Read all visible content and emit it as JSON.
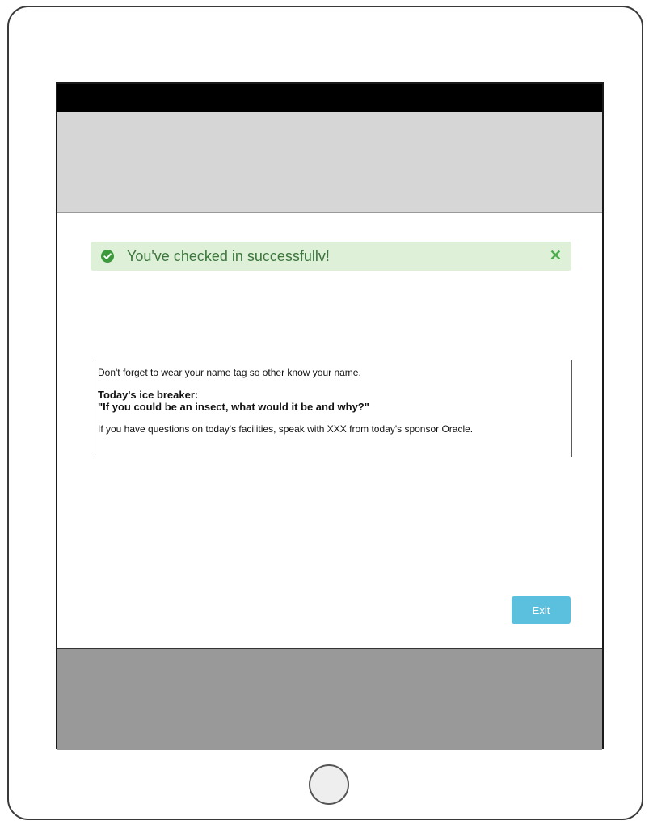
{
  "alert": {
    "message": "You've checked in successfullv!",
    "icon": "check-circle-icon",
    "close_icon": "close-icon",
    "close_glyph": "✕",
    "bg_color": "#dff0d8",
    "text_color": "#3c763d"
  },
  "info": {
    "line1": "Don't forget to wear your name tag so other know your name.",
    "ice_breaker_title": "Today's ice breaker:",
    "ice_breaker_question": "\"If you could be an insect, what would it be and why?\"",
    "line_sponsor": "If you have questions on today's facilities, speak with XXX from today's sponsor Oracle."
  },
  "actions": {
    "exit_label": "Exit",
    "exit_color": "#5bc0de"
  }
}
